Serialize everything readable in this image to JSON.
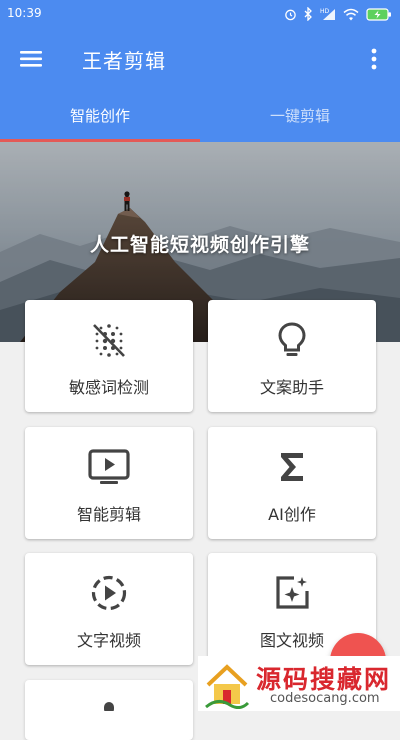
{
  "status_bar": {
    "time": "10:39",
    "icons": [
      "alarm-icon",
      "bluetooth-icon",
      "hd-signal-icon",
      "wifi-icon",
      "battery-charging-icon"
    ]
  },
  "toolbar": {
    "title": "王者剪辑",
    "menu_icon": "hamburger-menu-icon",
    "more_icon": "more-vertical-icon"
  },
  "tabs": [
    {
      "label": "智能创作",
      "active": true
    },
    {
      "label": "一键剪辑",
      "active": false
    }
  ],
  "hero": {
    "headline": "人工智能短视频创作引擎"
  },
  "features": [
    {
      "label": "敏感词检测",
      "icon": "blur-grid-off-icon"
    },
    {
      "label": "文案助手",
      "icon": "lightbulb-icon"
    },
    {
      "label": "智能剪辑",
      "icon": "tv-play-icon"
    },
    {
      "label": "AI创作",
      "icon": "sigma-icon"
    },
    {
      "label": "文字视频",
      "icon": "dashed-circle-play-icon"
    },
    {
      "label": "图文视频",
      "icon": "image-sparkle-icon"
    }
  ],
  "watermark": {
    "title": "源码搜藏网",
    "domain": "codesocang.com"
  },
  "colors": {
    "app_bar": "#4c8bf0",
    "tab_indicator": "#e35a57",
    "fab": "#ef5350",
    "background": "#f0f0f0"
  }
}
